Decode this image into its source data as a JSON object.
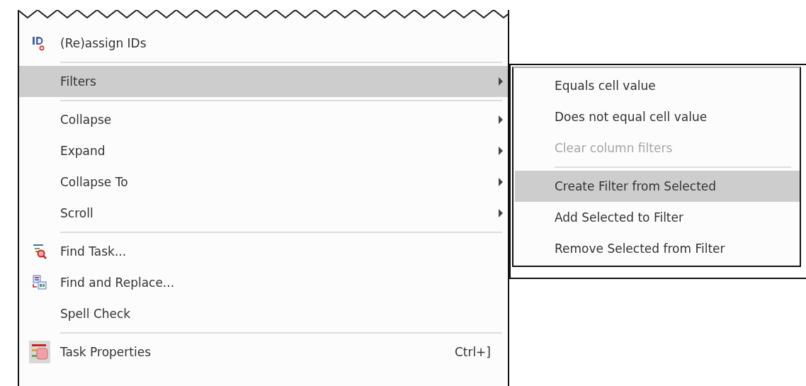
{
  "menu": {
    "items": [
      {
        "kind": "item",
        "label": "(Re)assign IDs",
        "submenu": false,
        "selected": false
      },
      {
        "kind": "separator"
      },
      {
        "kind": "item",
        "label": "Filters",
        "submenu": true,
        "selected": true
      },
      {
        "kind": "separator"
      },
      {
        "kind": "item",
        "label": "Collapse",
        "submenu": true,
        "selected": false
      },
      {
        "kind": "item",
        "label": "Expand",
        "submenu": true,
        "selected": false
      },
      {
        "kind": "item",
        "label": "Collapse To",
        "submenu": true,
        "selected": false
      },
      {
        "kind": "item",
        "label": "Scroll",
        "submenu": true,
        "selected": false
      },
      {
        "kind": "separator"
      },
      {
        "kind": "item",
        "label": "Find Task...",
        "submenu": false,
        "selected": false
      },
      {
        "kind": "item",
        "label": "Find and Replace...",
        "submenu": false,
        "selected": false
      },
      {
        "kind": "item",
        "label": "Spell Check",
        "submenu": false,
        "selected": false
      },
      {
        "kind": "separator"
      },
      {
        "kind": "item",
        "label": "Task Properties",
        "shortcut": "Ctrl+]",
        "submenu": false,
        "selected": false
      }
    ]
  },
  "submenu": {
    "items": [
      {
        "kind": "item",
        "label": "Equals cell value",
        "disabled": false,
        "selected": false
      },
      {
        "kind": "item",
        "label": "Does not equal cell value",
        "disabled": false,
        "selected": false
      },
      {
        "kind": "item",
        "label": "Clear column filters",
        "disabled": true,
        "selected": false
      },
      {
        "kind": "separator"
      },
      {
        "kind": "item",
        "label": "Create Filter from Selected",
        "disabled": false,
        "selected": true
      },
      {
        "kind": "item",
        "label": "Add Selected to Filter",
        "disabled": false,
        "selected": false
      },
      {
        "kind": "item",
        "label": "Remove Selected from Filter",
        "disabled": false,
        "selected": false
      }
    ]
  }
}
